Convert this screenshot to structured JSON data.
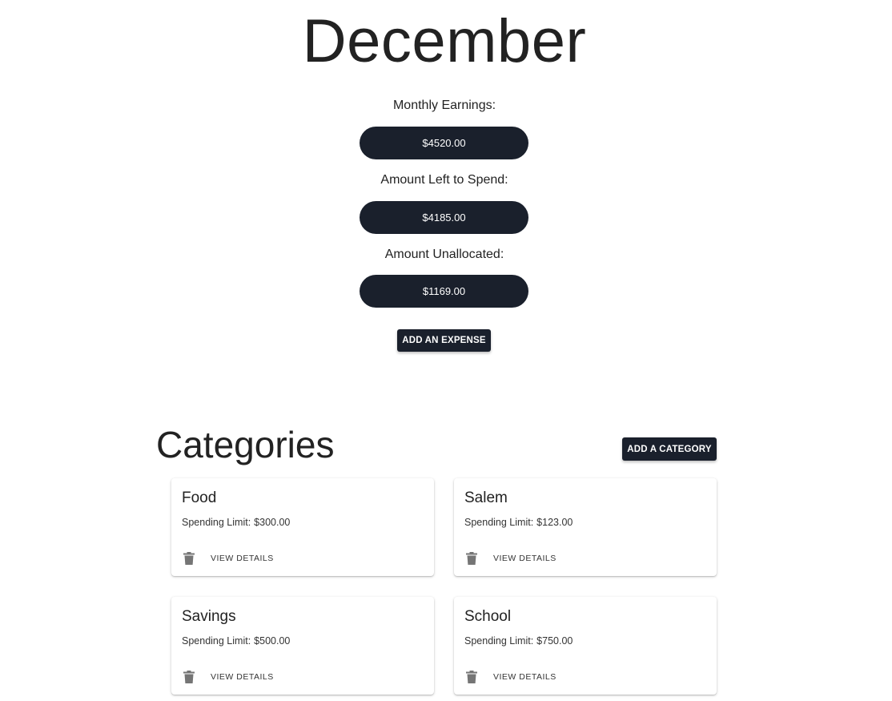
{
  "month": "December",
  "stats": [
    {
      "label": "Monthly Earnings:",
      "value": "$4520.00"
    },
    {
      "label": "Amount Left to Spend:",
      "value": "$4185.00"
    },
    {
      "label": "Amount Unallocated:",
      "value": "$1169.00"
    }
  ],
  "add_expense_label": "ADD AN EXPENSE",
  "categories_section": {
    "title": "Categories",
    "add_category_label": "ADD A CATEGORY",
    "limit_label": "Spending Limit:",
    "details_label": "VIEW DETAILS",
    "items": [
      {
        "name": "Food",
        "limit": "$300.00"
      },
      {
        "name": "Salem",
        "limit": "$123.00"
      },
      {
        "name": "Savings",
        "limit": "$500.00"
      },
      {
        "name": "School",
        "limit": "$750.00"
      }
    ]
  },
  "icons": {
    "delete": "trash-icon"
  },
  "colors": {
    "primary_dark": "#1a202c",
    "icon_gray": "#757575",
    "text": "#222222",
    "background": "#ffffff"
  }
}
